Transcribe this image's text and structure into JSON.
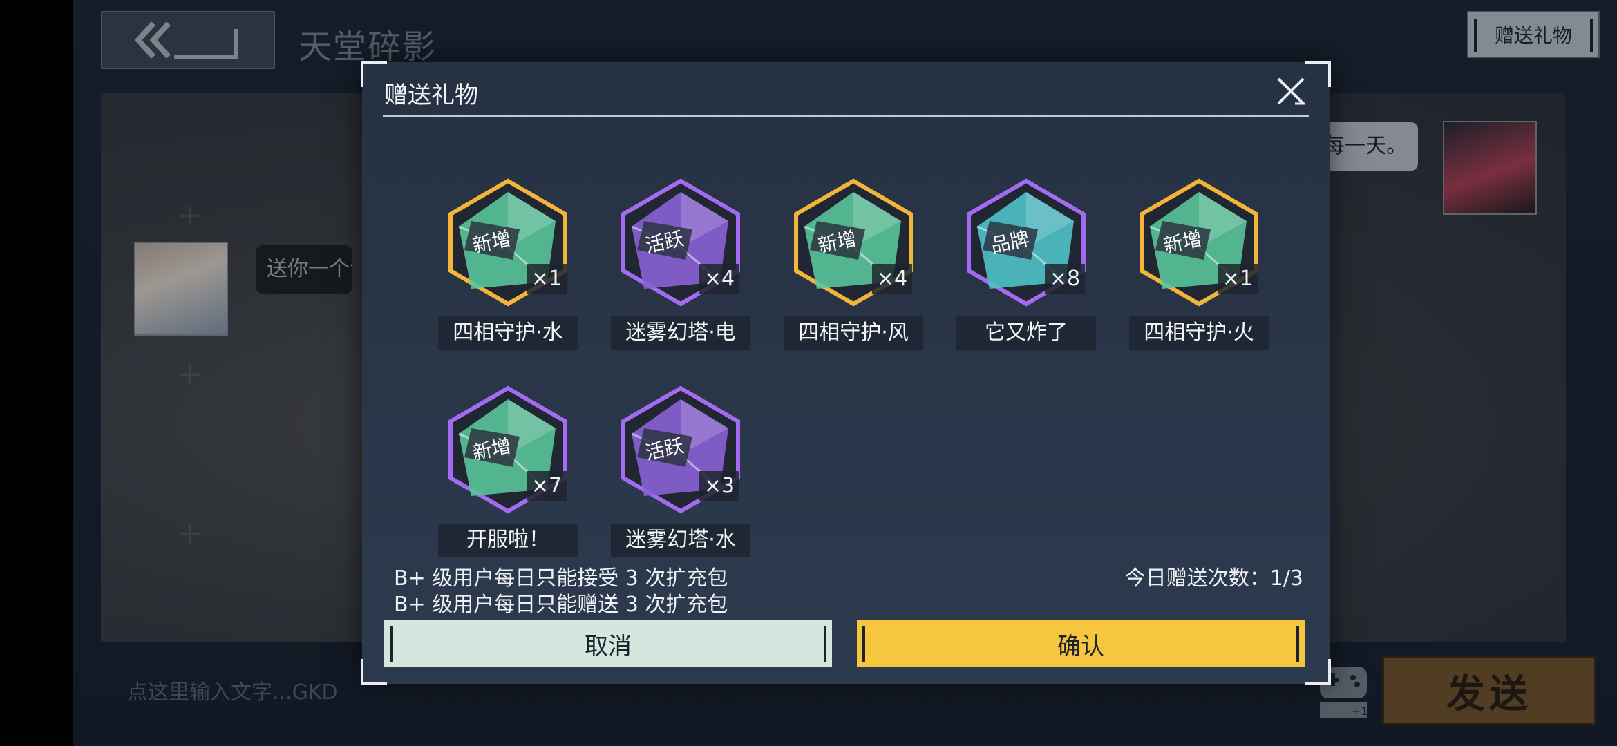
{
  "header": {
    "room_title": "天堂碎影",
    "gift_button": "赠送礼物"
  },
  "chat": {
    "left_message": "送你一个包",
    "right_message": "每一天。"
  },
  "input": {
    "placeholder": "点这里输入文字...GKD",
    "send_button": "发送",
    "gamepad_badge": "+1"
  },
  "modal": {
    "title": "赠送礼物",
    "gifts": [
      {
        "name": "四相守护·水",
        "count": "×1",
        "badge": "新增",
        "frame": "gold"
      },
      {
        "name": "迷雾幻塔·电",
        "count": "×4",
        "badge": "活跃",
        "frame": "purple"
      },
      {
        "name": "四相守护·风",
        "count": "×4",
        "badge": "新增",
        "frame": "gold"
      },
      {
        "name": "它又炸了",
        "count": "×8",
        "badge": "品牌",
        "frame": "purple-flat"
      },
      {
        "name": "四相守护·火",
        "count": "×1",
        "badge": "新增",
        "frame": "gold"
      },
      {
        "name": "开服啦！",
        "count": "×7",
        "badge": "新增",
        "frame": "purple"
      },
      {
        "name": "迷雾幻塔·水",
        "count": "×3",
        "badge": "活跃",
        "frame": "purple"
      }
    ],
    "rule_receive": "B+ 级用户每日只能接受 3 次扩充包",
    "rule_send": "B+ 级用户每日只能赠送 3 次扩充包",
    "daily_count": "今日赠送次数：1/3",
    "cancel_label": "取消",
    "confirm_label": "确认"
  },
  "colors": {
    "confirm": "#f7c63f",
    "cancel": "#d4e6de",
    "send": "#7a5a2e",
    "gold_frame": "#f3b43a",
    "purple_frame": "#a36bf0",
    "green_gem": "#59c59a"
  }
}
